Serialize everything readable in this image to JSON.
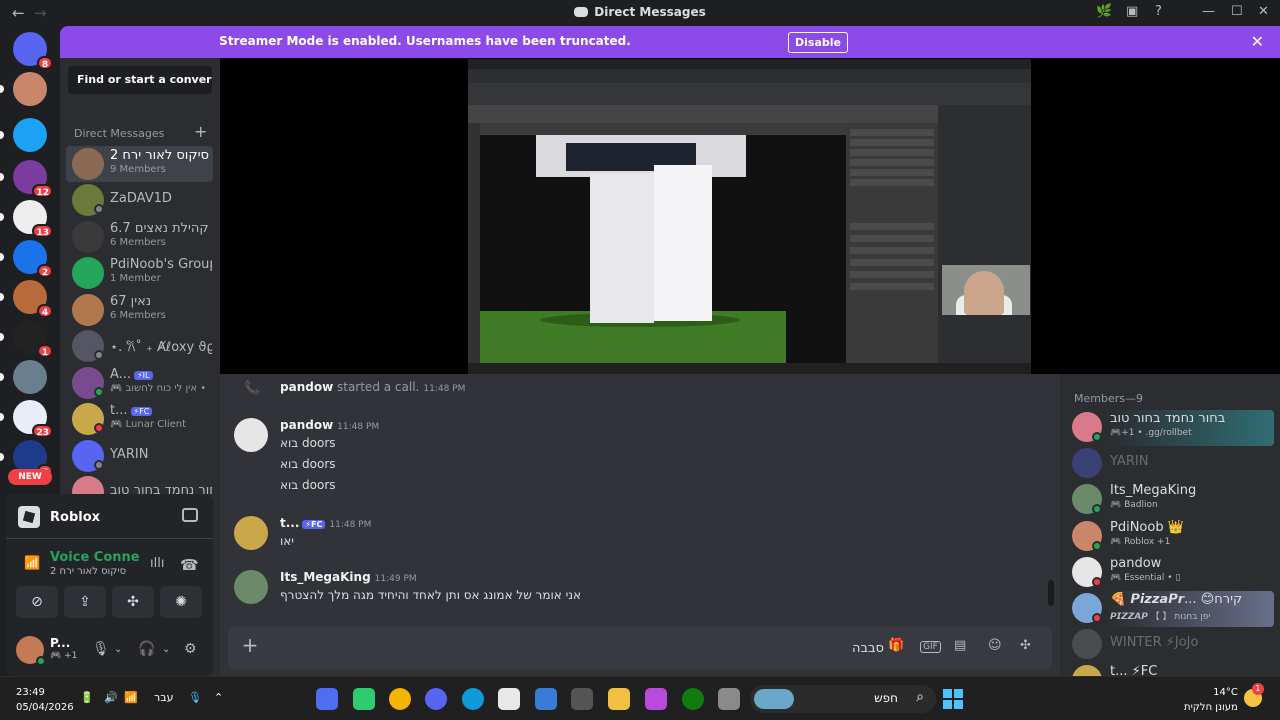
{
  "window": {
    "title": "Direct Messages"
  },
  "banner": {
    "message": "Streamer Mode is enabled. Usernames have been truncated.",
    "disable_label": "Disable"
  },
  "rail": {
    "servers": [
      {
        "name": "home-icon",
        "badge": "8",
        "color": "#5865f2"
      },
      {
        "name": "server-avatar-1",
        "badge": "",
        "color": "#c8866b"
      },
      {
        "name": "server-tv",
        "badge": "",
        "color": "#1da1f2"
      },
      {
        "name": "server-2",
        "badge": "12",
        "color": "#7a3c9e"
      },
      {
        "name": "server-sc",
        "badge": "13",
        "color": "#eeeeee"
      },
      {
        "name": "server-3",
        "badge": "2",
        "color": "#1a73e8"
      },
      {
        "name": "server-4",
        "badge": "4",
        "color": "#b86a3b"
      },
      {
        "name": "server-5",
        "badge": "1",
        "color": "#222222"
      },
      {
        "name": "server-6",
        "badge": "",
        "color": "#6a7f8e"
      },
      {
        "name": "server-israel",
        "badge": "23",
        "color": "#e8eef8"
      },
      {
        "name": "server-7",
        "badge": "7",
        "color": "#1e3a8a"
      }
    ],
    "new_label": "NEW"
  },
  "sidebar": {
    "search_placeholder": "Find or start a convers...",
    "dm_header": "Direct Messages",
    "dms": [
      {
        "name": "סיקוס לאור ירח 2",
        "sub": "9 Members",
        "color": "#8b6a55",
        "status": "",
        "active": true
      },
      {
        "name": "ZaDAV1D",
        "sub": "",
        "color": "#6b7a3a",
        "status": "idle"
      },
      {
        "name": "קהילת נאצים 6.7",
        "sub": "6 Members",
        "color": "#3a3a3a",
        "status": ""
      },
      {
        "name": "PdiNoob's Group",
        "sub": "1 Member",
        "color": "#23a55a",
        "status": ""
      },
      {
        "name": "נאין 67",
        "sub": "6 Members",
        "color": "#b0774d",
        "status": ""
      },
      {
        "name": "⋆. 𐙚˚ ₊ Ⱥℓoxy ϑϱ˖⋆",
        "sub": "",
        "color": "#555566",
        "status": "idle"
      },
      {
        "name": "A...",
        "tag": "⚡IL",
        "sub": "🎮 אין לי כוח לחשוב •",
        "color": "#7a4a8e",
        "status": "online"
      },
      {
        "name": "t...",
        "tag": "⚡FC",
        "sub": "🎮 Lunar Client",
        "color": "#c8a84b",
        "status": "dnd"
      },
      {
        "name": "YARIN",
        "sub": "",
        "color": "#5865f2",
        "status": "idle"
      },
      {
        "name": "בחור נחמד בחור טוב",
        "sub": "",
        "color": "#d87a8a",
        "status": ""
      }
    ]
  },
  "voice": {
    "activity_name": "Roblox",
    "status": "Voice Connecte",
    "channel": "סיקוס לאור ירח 2",
    "user_name": "P...",
    "user_sub": "🎮 +1"
  },
  "chat": {
    "call": {
      "user": "pandow",
      "text": "started a call.",
      "time": "11:48 PM"
    },
    "messages": [
      {
        "user": "pandow",
        "time": "11:48 PM",
        "tag": "",
        "color": "#e6e6e6",
        "lines": [
          "בוא doors",
          "בוא doors",
          "בוא doors"
        ]
      },
      {
        "user": "t...",
        "time": "11:48 PM",
        "tag": "⚡FC",
        "color": "#c8a84b",
        "lines": [
          "יאו"
        ]
      },
      {
        "user": "Its_MegaKing",
        "time": "11:49 PM",
        "tag": "",
        "color": "#6a8a6a",
        "lines": [
          "אני אומר של אמונג אס ותן לאחד והיחיד מגה מלך להצטרף"
        ]
      }
    ],
    "composer_value": "סבבה"
  },
  "members": {
    "header": "Members—9",
    "list": [
      {
        "name": "בחור נחמד בחור טוב",
        "sub": "🎮+1 • .gg/rollbet",
        "color": "#d87a8a",
        "status": "online",
        "style": "hl"
      },
      {
        "name": "YARIN",
        "sub": "",
        "color": "#5865f2",
        "status": "",
        "style": "off"
      },
      {
        "name": "Its_MegaKing",
        "sub": "🎮 Badlion",
        "color": "#6a8a6a",
        "status": "online",
        "style": ""
      },
      {
        "name": "PdiNoob 👑",
        "sub": "🎮 Roblox +1",
        "color": "#c8866b",
        "status": "online",
        "style": ""
      },
      {
        "name": "pandow",
        "sub": "🎮 Essential • ▯",
        "color": "#e6e6e6",
        "status": "dnd",
        "style": ""
      },
      {
        "name": "🍕 𝙋𝙞𝙯𝙯𝙖𝙋𝙧... 😊קירח",
        "sub": "𝙋𝙄𝙕𝙕𝘼𝙋 【 】 יפן בחנות",
        "color": "#7aa6d8",
        "status": "dnd",
        "style": "hl2"
      },
      {
        "name": "WINTER ⚡JoJo",
        "sub": "",
        "color": "#888888",
        "status": "",
        "style": "off"
      },
      {
        "name": "t... ⚡FC",
        "sub": "",
        "color": "#c8a84b",
        "status": "",
        "style": ""
      }
    ]
  },
  "taskbar": {
    "time": "23:49",
    "date": "05/04/2026",
    "lang": "עבר",
    "search_text": "חפש",
    "temp": "14°C",
    "weather_text": "מעונן חלקית",
    "weather_badge": "1"
  }
}
